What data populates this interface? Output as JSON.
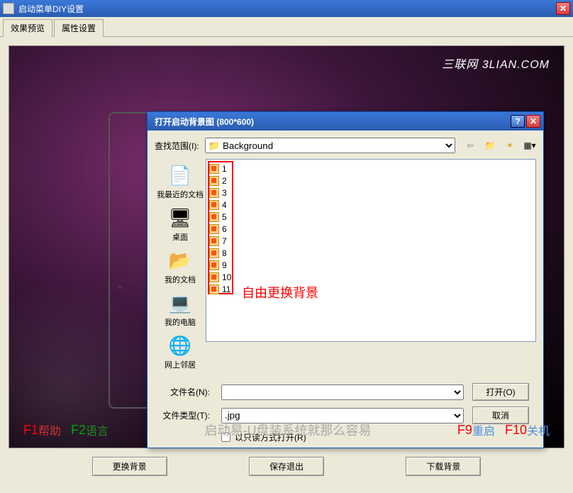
{
  "main": {
    "title": "启动菜单DIY设置",
    "tabs": [
      "效果预览",
      "属性设置"
    ],
    "watermark": "三联网 3LIAN.COM",
    "center_tag": "启动易-U盘装系统就那么容易",
    "fkeys": {
      "f1": "F1",
      "f1txt": "帮助",
      "f2": "F2",
      "f2txt": "语言",
      "f9": "F9",
      "f9txt": "重启",
      "f10": "F10",
      "f10txt": "关机"
    },
    "buttons": {
      "change_bg": "更换背景",
      "save_exit": "保存退出",
      "download_bg": "下载背景"
    }
  },
  "dialog": {
    "title": "打开启动背景图 (800*600)",
    "lookin_label": "查找范围(I):",
    "lookin_value": "Background",
    "places": {
      "recent": "我最近的文档",
      "desktop": "桌面",
      "mydocs": "我的文档",
      "mycomputer": "我的电脑",
      "network": "网上邻居"
    },
    "files": [
      "1",
      "2",
      "3",
      "4",
      "5",
      "6",
      "7",
      "8",
      "9",
      "10",
      "11"
    ],
    "annotation": "自由更换背景",
    "filename_label": "文件名(N):",
    "filename_value": "",
    "filetype_label": "文件类型(T):",
    "filetype_value": ".jpg",
    "readonly_label": "以只读方式打开(R)",
    "open_btn": "打开(O)",
    "cancel_btn": "取消"
  }
}
